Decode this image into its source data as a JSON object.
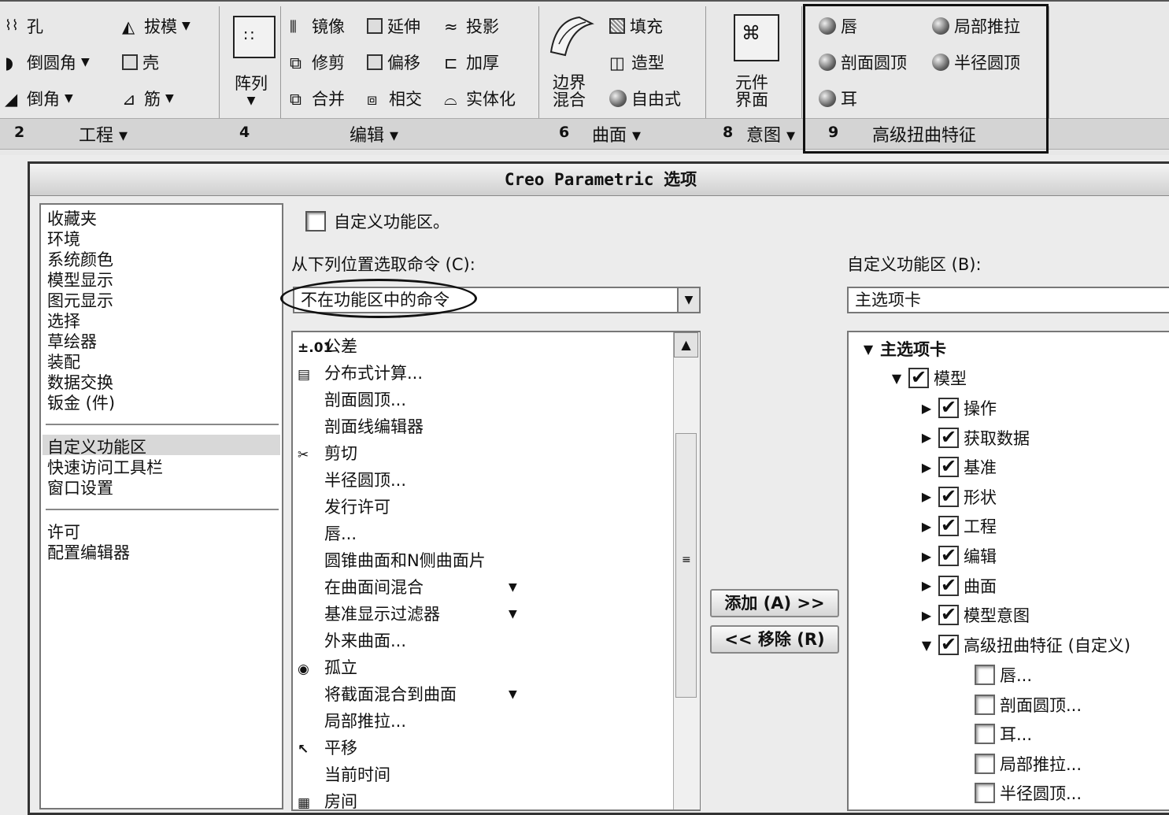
{
  "ribbon": {
    "engineering": {
      "hole": "孔",
      "draft": "拔模",
      "round": "倒圆角",
      "shell": "壳",
      "chamfer": "倒角",
      "rib": "筋"
    },
    "pattern": {
      "label": "阵列"
    },
    "editing": {
      "mirror": "镜像",
      "extend": "延伸",
      "project": "投影",
      "trim": "修剪",
      "offset": "偏移",
      "thicken": "加厚",
      "merge": "合并",
      "intersect": "相交",
      "solidify": "实体化"
    },
    "surfaces": {
      "boundary": "边界\n混合",
      "fill": "填充",
      "style": "造型",
      "freestyle": "自由式"
    },
    "intent": {
      "component_interface": "元件\n界面"
    },
    "advanced": {
      "lip": "唇",
      "local_push": "局部推拉",
      "section_dome": "剖面圆顶",
      "radius_dome": "半径圆顶",
      "ear": "耳"
    },
    "groups": [
      {
        "num": "2",
        "label": "工程 ▾"
      },
      {
        "num": "4",
        "label": "编辑 ▾"
      },
      {
        "num": "6",
        "label": "曲面 ▾"
      },
      {
        "num": "8",
        "label": "意图 ▾"
      },
      {
        "num": "9",
        "label": "高级扭曲特征"
      }
    ]
  },
  "dialog": {
    "title": "Creo Parametric 选项",
    "nav_groups": [
      [
        "收藏夹",
        "环境",
        "系统颜色",
        "模型显示",
        "图元显示",
        "选择",
        "草绘器",
        "装配",
        "数据交换",
        "钣金 (件)"
      ],
      [
        "自定义功能区",
        "快速访问工具栏",
        "窗口设置"
      ],
      [
        "许可",
        "配置编辑器"
      ]
    ],
    "customize_checkbox_label": "自定义功能区。",
    "choose_from_label": "从下列位置选取命令 (C):",
    "choose_from_value": "不在功能区中的命令",
    "customize_label": "自定义功能区 (B):",
    "customize_value": "主选项卡",
    "commands": [
      {
        "icon": "±.01",
        "label": "公差",
        "sub": ""
      },
      {
        "icon": "▤",
        "label": "分布式计算...",
        "sub": ""
      },
      {
        "icon": "",
        "label": "剖面圆顶...",
        "sub": ""
      },
      {
        "icon": "",
        "label": "剖面线编辑器",
        "sub": ""
      },
      {
        "icon": "✂",
        "label": "剪切",
        "sub": ""
      },
      {
        "icon": "",
        "label": "半径圆顶...",
        "sub": ""
      },
      {
        "icon": "",
        "label": "发行许可",
        "sub": ""
      },
      {
        "icon": "",
        "label": "唇...",
        "sub": ""
      },
      {
        "icon": "",
        "label": "圆锥曲面和N侧曲面片",
        "sub": ""
      },
      {
        "icon": "",
        "label": "在曲面间混合",
        "sub": "▼"
      },
      {
        "icon": "",
        "label": "基准显示过滤器",
        "sub": "▼"
      },
      {
        "icon": "",
        "label": "外来曲面...",
        "sub": ""
      },
      {
        "icon": "◉",
        "label": "孤立",
        "sub": ""
      },
      {
        "icon": "",
        "label": "将截面混合到曲面",
        "sub": "▼"
      },
      {
        "icon": "",
        "label": "局部推拉...",
        "sub": ""
      },
      {
        "icon": "↖",
        "label": "平移",
        "sub": ""
      },
      {
        "icon": "",
        "label": "当前时间",
        "sub": ""
      },
      {
        "icon": "▦",
        "label": "房间",
        "sub": ""
      }
    ],
    "add_button": "添加 (A) >>",
    "remove_button": "<< 移除 (R)",
    "tree": {
      "root": "主选项卡",
      "model": "模型",
      "children": [
        "操作",
        "获取数据",
        "基准",
        "形状",
        "工程",
        "编辑",
        "曲面",
        "模型意图"
      ],
      "custom_group": "高级扭曲特征 (自定义)",
      "custom_items": [
        "唇...",
        "剖面圆顶...",
        "耳...",
        "局部推拉...",
        "半径圆顶..."
      ]
    }
  }
}
